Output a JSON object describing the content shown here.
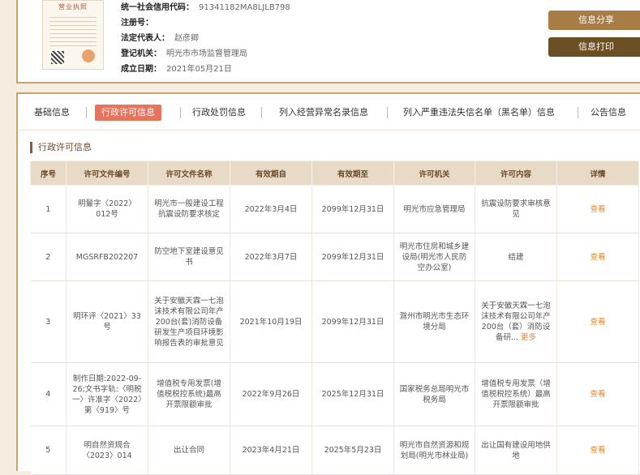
{
  "company": {
    "license_title": "营业执照",
    "fields": [
      {
        "key": "统一社会信用代码：",
        "value": "91341182MA8LJLB798"
      },
      {
        "key": "注册号：",
        "value": ""
      },
      {
        "key": "法定代表人：",
        "value": "赵彦卿"
      },
      {
        "key": "登记机关：",
        "value": "明光市市场监督管理局"
      },
      {
        "key": "成立日期：",
        "value": "2021年05月21日"
      }
    ]
  },
  "actions": {
    "share_label": "信息分享",
    "print_label": "信息打印"
  },
  "tabs": [
    {
      "label": "基础信息"
    },
    {
      "label": "行政许可信息"
    },
    {
      "label": "行政处罚信息"
    },
    {
      "label": "列入经营异常名录信息"
    },
    {
      "label": "列入严重违法失信名单（黑名单）信息"
    },
    {
      "label": "公告信息"
    }
  ],
  "section": {
    "title": "行政许可信息"
  },
  "table": {
    "headers": [
      "序号",
      "许可文件编号",
      "许可文件名称",
      "有效期自",
      "有效期至",
      "许可机关",
      "许可内容",
      "详情"
    ],
    "rows": [
      {
        "no": "1",
        "doc_no": "明鬘字〈2022〉012号",
        "name": "明光市一般建设工程抗震设防要求核定",
        "from": "2022年3月4日",
        "to": "2099年12月31日",
        "authority": "明光市应急管理局",
        "content": "抗震设防要求审核意见",
        "more": "",
        "detail": "查看"
      },
      {
        "no": "2",
        "doc_no": "MGSRFB202207",
        "name": "防空地下室建设意见书",
        "from": "2022年3月7日",
        "to": "2099年12月31日",
        "authority": "明光市住房和城乡建设局(明光市人民防空办公室)",
        "content": "结建",
        "more": "",
        "detail": "查看"
      },
      {
        "no": "3",
        "doc_no": "明环评〈2021〉33号",
        "name": "关于安徽天霖一七泡沫技术有限公司年产200台(套)消防设备研发生产项目环境影响报告表的审批意见",
        "from": "2021年10月19日",
        "to": "2099年12月31日",
        "authority": "滁州市明光市生态环境分局",
        "content": "关于安徽天霖一七泡沫技术有限公司年产200台（套）消防设备研...",
        "more": "更多",
        "detail": "查看"
      },
      {
        "no": "4",
        "doc_no": "制作日期:2022-09-26;文书字轨:〈明税一〉许准字〈2022〉第〈919〉号",
        "name": "增值税专用发票(增值税税控系统)最高开票限额审批",
        "from": "2022年9月26日",
        "to": "2025年12月31日",
        "authority": "国家税务总局明光市税务局",
        "content": "增值税专用发票（增值税税控系统）最高开票限额审批",
        "more": "",
        "detail": "查看"
      },
      {
        "no": "5",
        "doc_no": "明自然资规合〈2023〉014",
        "name": "出让合同",
        "from": "2023年4月21日",
        "to": "2025年5月23日",
        "authority": "明光市自然资源和规划局(明光市林业局)",
        "content": "出让国有建设用地供地",
        "more": "",
        "detail": "查看"
      }
    ]
  }
}
